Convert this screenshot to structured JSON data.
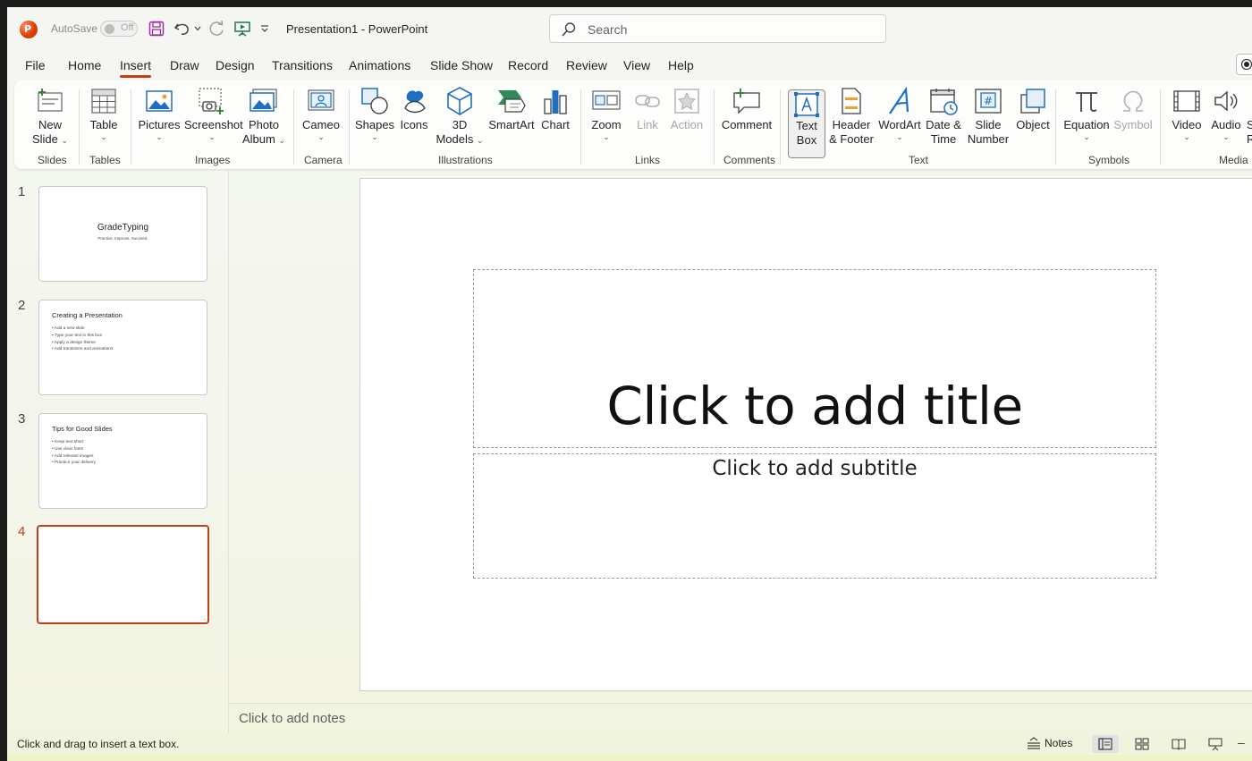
{
  "titlebar": {
    "autosave_label": "AutoSave",
    "autosave_state": "Off",
    "document_title": "Presentation1  -  PowerPoint",
    "search_placeholder": "Search",
    "brand_color": "#c43e1c"
  },
  "tabs": [
    {
      "label": "File"
    },
    {
      "label": "Home"
    },
    {
      "label": "Insert",
      "active": true
    },
    {
      "label": "Draw"
    },
    {
      "label": "Design"
    },
    {
      "label": "Transitions"
    },
    {
      "label": "Animations"
    },
    {
      "label": "Slide Show"
    },
    {
      "label": "Record"
    },
    {
      "label": "Review"
    },
    {
      "label": "View"
    },
    {
      "label": "Help"
    }
  ],
  "ribbon": {
    "buttons": {
      "new_slide": [
        "New",
        "Slide"
      ],
      "table": "Table",
      "pictures": "Pictures",
      "screenshot": "Screenshot",
      "photo_album": [
        "Photo",
        "Album"
      ],
      "cameo": "Cameo",
      "shapes": "Shapes",
      "icons": "Icons",
      "models_3d": [
        "3D",
        "Models"
      ],
      "smartart": "SmartArt",
      "chart": "Chart",
      "zoom": "Zoom",
      "link": "Link",
      "action": "Action",
      "comment": "Comment",
      "text_box": [
        "Text",
        "Box"
      ],
      "header_footer": [
        "Header",
        "& Footer"
      ],
      "wordart": "WordArt",
      "date_time": [
        "Date &",
        "Time"
      ],
      "slide_number": [
        "Slide",
        "Number"
      ],
      "object": "Object",
      "equation": "Equation",
      "symbol": "Symbol",
      "video": "Video",
      "audio": "Audio",
      "screen_rec": [
        "S",
        "Re"
      ]
    },
    "groups": {
      "slides": "Slides",
      "tables": "Tables",
      "images": "Images",
      "camera": "Camera",
      "illustrations": "Illustrations",
      "links": "Links",
      "comments": "Comments",
      "text": "Text",
      "symbols": "Symbols",
      "media": "Media"
    }
  },
  "slides": [
    {
      "number": "1",
      "title": "GradeTyping",
      "subtitle": "Practice. Improve. Succeed."
    },
    {
      "number": "2",
      "title": "Creating a Presentation",
      "bullets": [
        "• Add a new slide",
        "• Type your text in this box",
        "• Apply a design theme",
        "• Add transitions and animations"
      ]
    },
    {
      "number": "3",
      "title": "Tips for Good Slides",
      "bullets": [
        "• Keep text short",
        "• Use clear fonts",
        "• Add relevant images",
        "• Practice your delivery"
      ]
    },
    {
      "number": "4",
      "active": true
    }
  ],
  "canvas": {
    "title_placeholder": "Click to add title",
    "subtitle_placeholder": "Click to add subtitle"
  },
  "notes_placeholder": "Click to add notes",
  "statusbar": {
    "message": "Click and drag to insert a text box.",
    "notes_label": "Notes",
    "zoom_out": "–"
  }
}
